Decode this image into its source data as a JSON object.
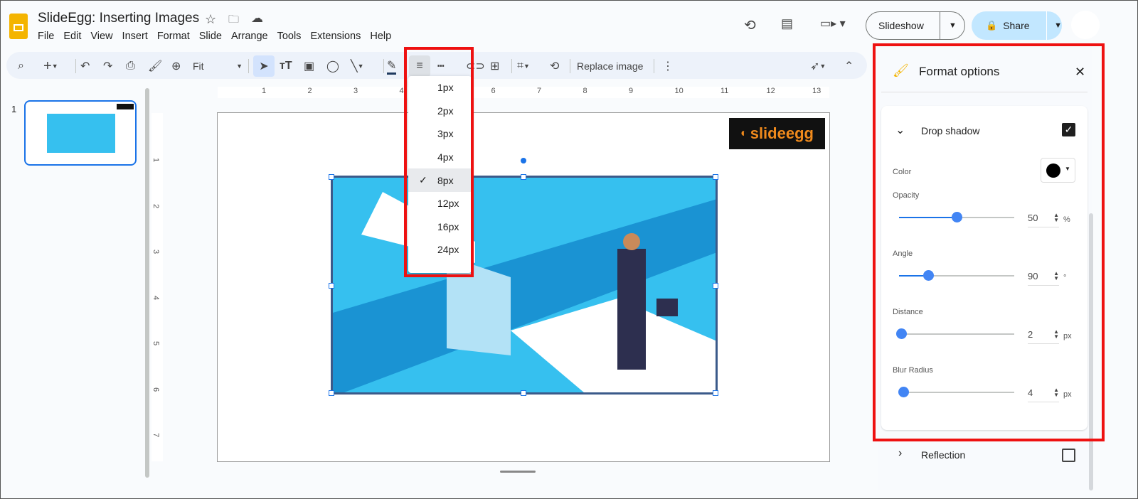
{
  "app": {
    "title": "SlideEgg: Inserting Images",
    "menu": [
      "File",
      "Edit",
      "View",
      "Insert",
      "Format",
      "Slide",
      "Arrange",
      "Tools",
      "Extensions",
      "Help"
    ],
    "slideshow_label": "Slideshow",
    "share_label": "Share"
  },
  "toolbar": {
    "zoom_value": "Fit",
    "replace_image_label": "Replace image"
  },
  "weight_menu": {
    "options": [
      "1px",
      "2px",
      "3px",
      "4px",
      "8px",
      "12px",
      "16px",
      "24px"
    ],
    "selected": "8px"
  },
  "filmstrip": {
    "slide_number": "1"
  },
  "ruler": {
    "h": [
      "1",
      "2",
      "3",
      "4",
      "5",
      "6",
      "7",
      "8",
      "9",
      "10",
      "11",
      "12",
      "13"
    ],
    "v": [
      "1",
      "2",
      "3",
      "4",
      "5",
      "6",
      "7"
    ]
  },
  "slide": {
    "logo_text": "slideegg"
  },
  "format_panel": {
    "title": "Format options",
    "section": "Drop shadow",
    "drop_shadow_checked": true,
    "color_label": "Color",
    "color_value": "#000000",
    "opacity": {
      "label": "Opacity",
      "value": "50",
      "unit": "%",
      "fraction": 0.5
    },
    "angle": {
      "label": "Angle",
      "value": "90",
      "unit": "°",
      "fraction": 0.25
    },
    "distance": {
      "label": "Distance",
      "value": "2",
      "unit": "px",
      "fraction": 0.02
    },
    "blur": {
      "label": "Blur Radius",
      "value": "4",
      "unit": "px",
      "fraction": 0.04
    },
    "reflection_label": "Reflection",
    "reflection_checked": false
  },
  "colors": {
    "accent": "#1a73e8",
    "highlight": "#e11111",
    "share_bg": "#c2e7ff"
  }
}
